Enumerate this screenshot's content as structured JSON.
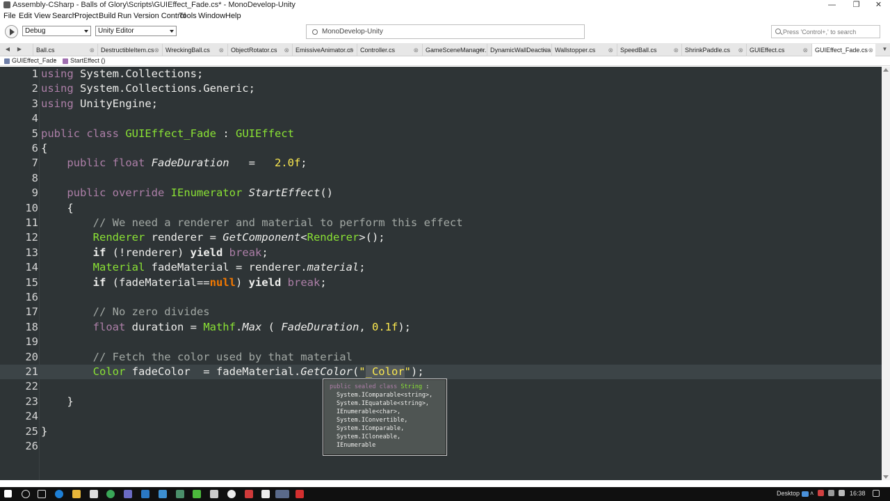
{
  "window": {
    "title": "Assembly-CSharp - Balls of Glory\\Scripts\\GUIEffect_Fade.cs* - MonoDevelop-Unity",
    "minimize": "—",
    "maximize": "❐",
    "close": "✕"
  },
  "menu": [
    "File",
    "Edit",
    "View",
    "Search",
    "Project",
    "Build",
    "Run",
    "Version Control",
    "Tools",
    "Window",
    "Help"
  ],
  "toolbar": {
    "config": "Debug",
    "target": "Unity Editor",
    "status": "MonoDevelop-Unity",
    "search_placeholder": "Press 'Control+,' to search"
  },
  "tabs": [
    {
      "label": "Ball.cs"
    },
    {
      "label": "DestructibleItem.cs"
    },
    {
      "label": "WreckingBall.cs"
    },
    {
      "label": "ObjectRotator.cs"
    },
    {
      "label": "EmissiveAnimator.cs"
    },
    {
      "label": "Controller.cs"
    },
    {
      "label": "GameSceneManager.cs"
    },
    {
      "label": "DynamicWallDeactivator.cs"
    },
    {
      "label": "Wallstopper.cs"
    },
    {
      "label": "SpeedBall.cs"
    },
    {
      "label": "ShrinkPaddle.cs"
    },
    {
      "label": "GUIEffect.cs"
    },
    {
      "label": "GUIEffect_Fade.cs",
      "active": true
    }
  ],
  "breadcrumb": {
    "class_name": "GUIEffect_Fade",
    "method_name": "StartEffect ()"
  },
  "editor": {
    "line_numbers": [
      "1",
      "2",
      "3",
      "4",
      "5",
      "6",
      "7",
      "8",
      "9",
      "10",
      "11",
      "12",
      "13",
      "14",
      "15",
      "16",
      "17",
      "18",
      "19",
      "20",
      "21",
      "22",
      "23",
      "24",
      "25",
      "26"
    ],
    "current_line": 21
  },
  "tooltip": {
    "header_kw": "public sealed class",
    "header_type": "String",
    "header_colon": ":",
    "lines": [
      "System.IComparable<string>,",
      "System.IEquatable<string>,",
      "IEnumerable<char>,",
      "System.IConvertible,",
      "System.IComparable,",
      "System.ICloneable,",
      "IEnumerable"
    ]
  },
  "taskbar": {
    "desktop_label": "Desktop",
    "clock": "16:38"
  }
}
